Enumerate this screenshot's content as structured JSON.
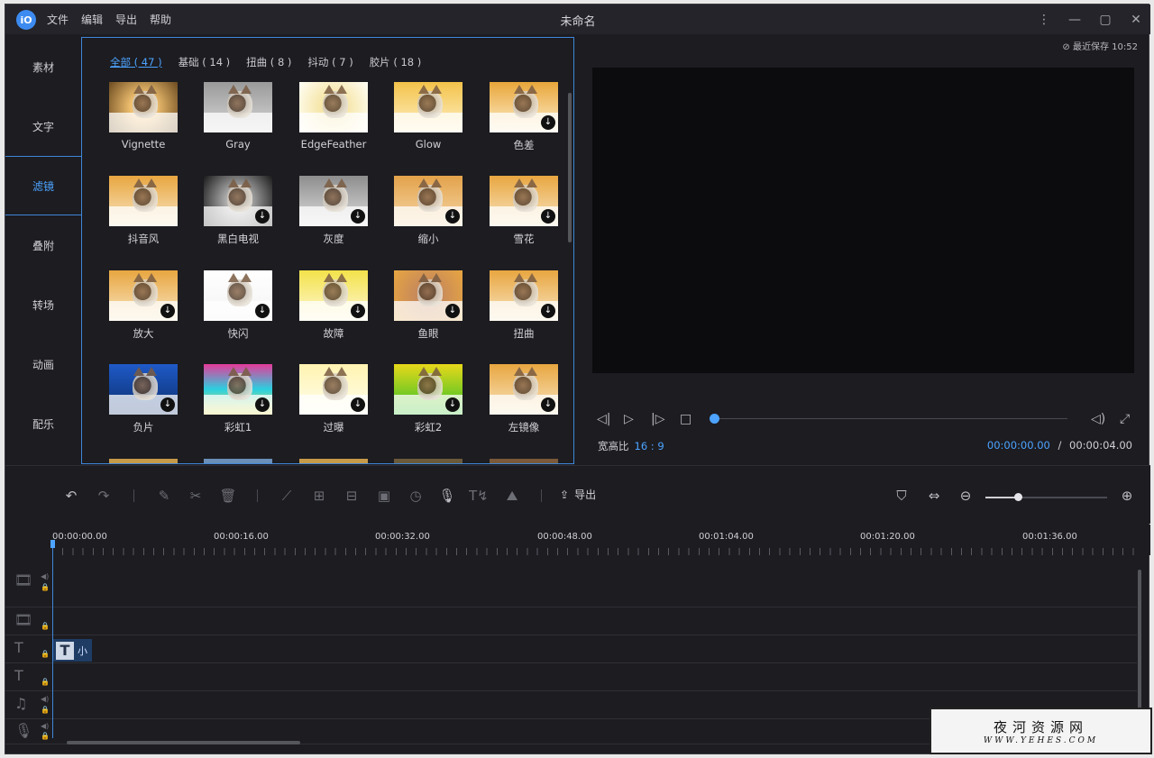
{
  "titlebar": {
    "logo": "iO",
    "menu": [
      "文件",
      "编辑",
      "导出",
      "帮助"
    ],
    "title": "未命名",
    "icons": [
      "more-vertical-icon",
      "minimize-icon",
      "maximize-icon",
      "close-icon"
    ]
  },
  "sidebar": {
    "items": [
      {
        "label": "素材"
      },
      {
        "label": "文字"
      },
      {
        "label": "滤镜",
        "active": true
      },
      {
        "label": "叠附"
      },
      {
        "label": "转场"
      },
      {
        "label": "动画"
      },
      {
        "label": "配乐"
      }
    ]
  },
  "filters": {
    "categories": [
      "全部 ( 47 )",
      "基础 ( 14 )",
      "扭曲 ( 8 )",
      "抖动 ( 7 )",
      "胶片 ( 18 )"
    ],
    "active_category": 0,
    "items": [
      {
        "label": "Vignette",
        "download": false,
        "bg": "radial-gradient(circle, #f0c070 30%, #6b4a20 100%)"
      },
      {
        "label": "Gray",
        "download": false,
        "bg": "linear-gradient(#9a9a9a, #d8d8d8)"
      },
      {
        "label": "EdgeFeather",
        "download": false,
        "bg": "radial-gradient(circle, #f6e6a8 30%, #fffef6 100%)"
      },
      {
        "label": "Glow",
        "download": false,
        "bg": "linear-gradient(#f3c24a, #fff2c8)"
      },
      {
        "label": "色差",
        "download": true,
        "bg": "linear-gradient(#e8a63a, #fff0cf)"
      },
      {
        "label": "抖音风",
        "download": false,
        "bg": "linear-gradient(#e8a640, #f9e7c5)"
      },
      {
        "label": "黑白电视",
        "download": true,
        "bg": "radial-gradient(circle, #bdbdbd 20%, #1a1a1a 100%)"
      },
      {
        "label": "灰度",
        "download": true,
        "bg": "linear-gradient(#8d8d8d, #e0e0e0)"
      },
      {
        "label": "缩小",
        "download": true,
        "bg": "linear-gradient(#e3a24a, #f6d8a8)"
      },
      {
        "label": "雪花",
        "download": true,
        "bg": "linear-gradient(#e8a640, #f9e7c5)"
      },
      {
        "label": "放大",
        "download": true,
        "bg": "linear-gradient(#e8a640, #f9e7c5)"
      },
      {
        "label": "快闪",
        "download": true,
        "bg": "linear-gradient(#ffffff, #f3f3f3)"
      },
      {
        "label": "故障",
        "download": true,
        "bg": "linear-gradient(#f3e24a, #fff8d8)"
      },
      {
        "label": "鱼眼",
        "download": true,
        "bg": "radial-gradient(circle, #c88a5a 30%, #e8a640 100%)"
      },
      {
        "label": "扭曲",
        "download": true,
        "bg": "linear-gradient(#e8a640, #f9e7c5)"
      },
      {
        "label": "负片",
        "download": true,
        "bg": "linear-gradient(#1f5ac8, #0a2d6a)"
      },
      {
        "label": "彩虹1",
        "download": true,
        "bg": "linear-gradient(#e63a9a, #2ad0e0 50%, #f6e04a)"
      },
      {
        "label": "过曝",
        "download": true,
        "bg": "linear-gradient(#fff3b0, #fffef0)"
      },
      {
        "label": "彩虹2",
        "download": true,
        "bg": "linear-gradient(#e8d81a, #2ac02a)"
      },
      {
        "label": "左镜像",
        "download": true,
        "bg": "linear-gradient(#e8a640, #f9e7c5)"
      }
    ],
    "partial_row_colors": [
      "#c79a4a",
      "#6a8fb8",
      "#c79a4a",
      "#6b5a3a",
      "#7a5a3a"
    ]
  },
  "preview": {
    "autosave": "最近保存 10:52",
    "aspect_label": "宽高比",
    "aspect_value": "16 : 9",
    "current_time": "00:00:00.00",
    "time_sep": "/",
    "total_time": "00:00:04.00",
    "progress": 0
  },
  "toolbar": {
    "export_label": "导出",
    "zoom_level": 0.27
  },
  "timeline": {
    "ruler": [
      "00:00:00.00",
      "00:00:16.00",
      "00:00:32.00",
      "00:00:48.00",
      "00:01:04.00",
      "00:01:20.00",
      "00:01:36.00"
    ],
    "clip_text": "小",
    "clip_icon": "T"
  },
  "watermark": {
    "line1": "夜河资源网",
    "line2": "WWW.YEHES.COM"
  },
  "colors": {
    "accent": "#4da3ff",
    "background": "#1c1c21",
    "titlebar": "#24242a"
  }
}
